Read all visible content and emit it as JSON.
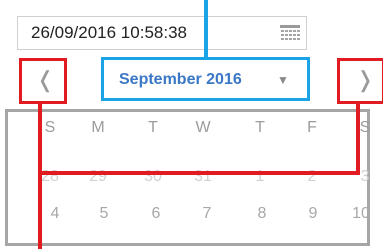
{
  "datetime_input": {
    "value": "26/09/2016 10:58:38",
    "calendar_icon": "calendar-grid-icon"
  },
  "navigation": {
    "prev_label": "❬",
    "next_label": "❭",
    "month_title": "September 2016",
    "month_caret": "▼"
  },
  "weekdays": [
    "S",
    "M",
    "T",
    "W",
    "T",
    "F",
    "S"
  ],
  "weeks": [
    [
      "28",
      "29",
      "30",
      "31",
      "1",
      "2",
      "3"
    ],
    [
      "4",
      "5",
      "6",
      "7",
      "8",
      "9",
      "10"
    ]
  ],
  "colors": {
    "highlight_red": "#e11b22",
    "highlight_blue": "#1aa3e6",
    "grid_gray": "#a6a6a6",
    "month_text": "#3a77c6"
  }
}
